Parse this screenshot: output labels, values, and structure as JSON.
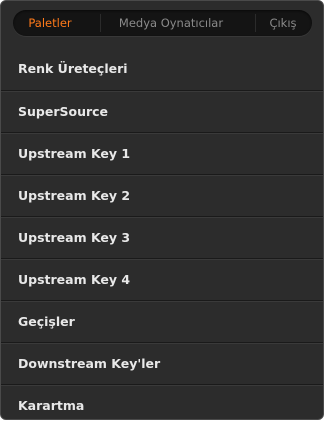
{
  "tabs": [
    {
      "label": "Paletler",
      "active": true
    },
    {
      "label": "Medya Oynatıcılar",
      "active": false
    },
    {
      "label": "Çıkış",
      "active": false
    }
  ],
  "menu": {
    "items": [
      {
        "label": "Renk Üreteçleri"
      },
      {
        "label": "SuperSource"
      },
      {
        "label": "Upstream Key 1"
      },
      {
        "label": "Upstream Key 2"
      },
      {
        "label": "Upstream Key 3"
      },
      {
        "label": "Upstream Key 4"
      },
      {
        "label": "Geçişler"
      },
      {
        "label": "Downstream Key'ler"
      },
      {
        "label": "Karartma"
      }
    ]
  },
  "colors": {
    "accent": "#ff7a1a",
    "panel_bg": "#2c2c2c",
    "text": "#e8e8e8",
    "tab_inactive": "#8a8a8a"
  }
}
